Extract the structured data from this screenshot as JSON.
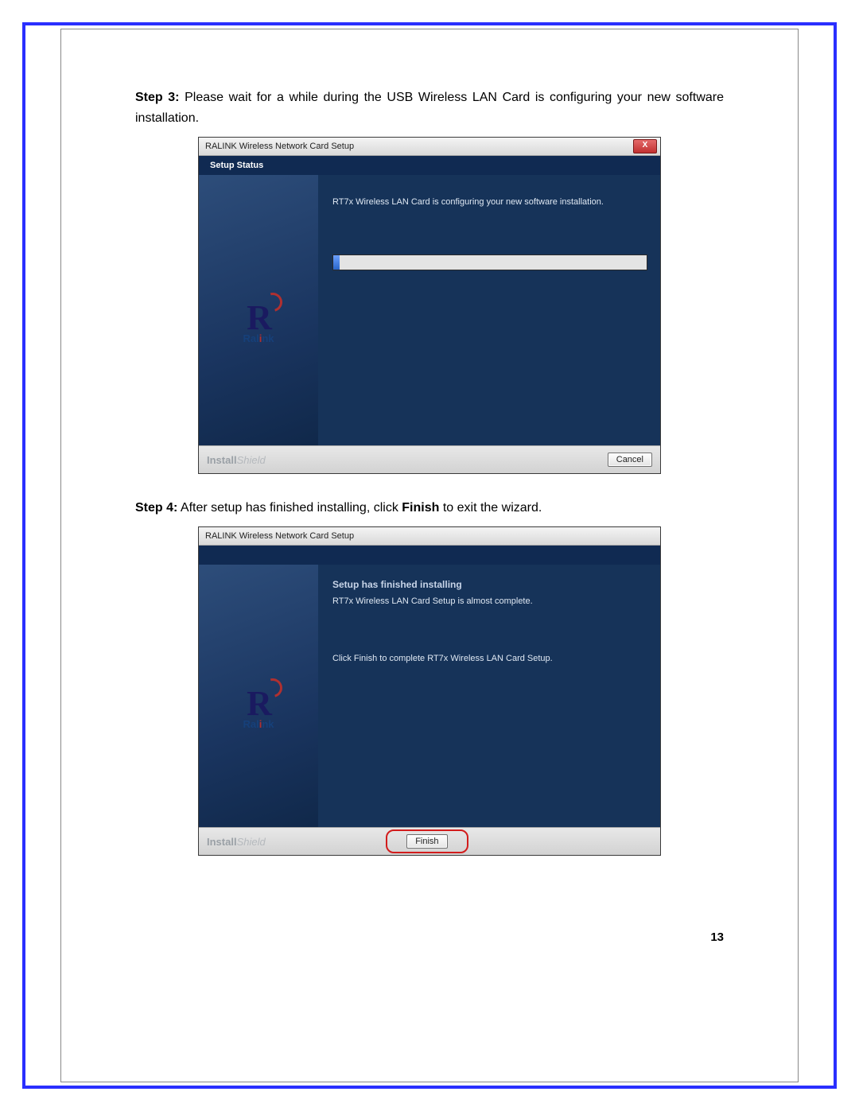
{
  "page": {
    "number": "13"
  },
  "steps": {
    "step3": {
      "label": "Step 3:",
      "text": "Please wait for a while during the USB Wireless LAN Card is configuring your new software installation."
    },
    "step4": {
      "label": "Step 4:",
      "text_before": "After setup has finished installing, click ",
      "bold_word": "Finish",
      "text_after": " to exit the wizard."
    }
  },
  "installer1": {
    "title": "RALINK Wireless Network Card Setup",
    "close_label": "X",
    "header": "Setup Status",
    "config_text": "RT7x Wireless LAN Card is configuring your new software installation.",
    "brand_install": "Install",
    "brand_shield": "Shield",
    "logo_text": "Ralink",
    "cancel_label": "Cancel"
  },
  "installer2": {
    "title": "RALINK Wireless Network Card Setup",
    "heading": "Setup has finished installing",
    "subtext": "RT7x Wireless LAN Card Setup is almost complete.",
    "instruction": "Click Finish to complete RT7x Wireless LAN Card Setup.",
    "brand_install": "Install",
    "brand_shield": "Shield",
    "logo_text": "Ralink",
    "finish_label": "Finish"
  }
}
